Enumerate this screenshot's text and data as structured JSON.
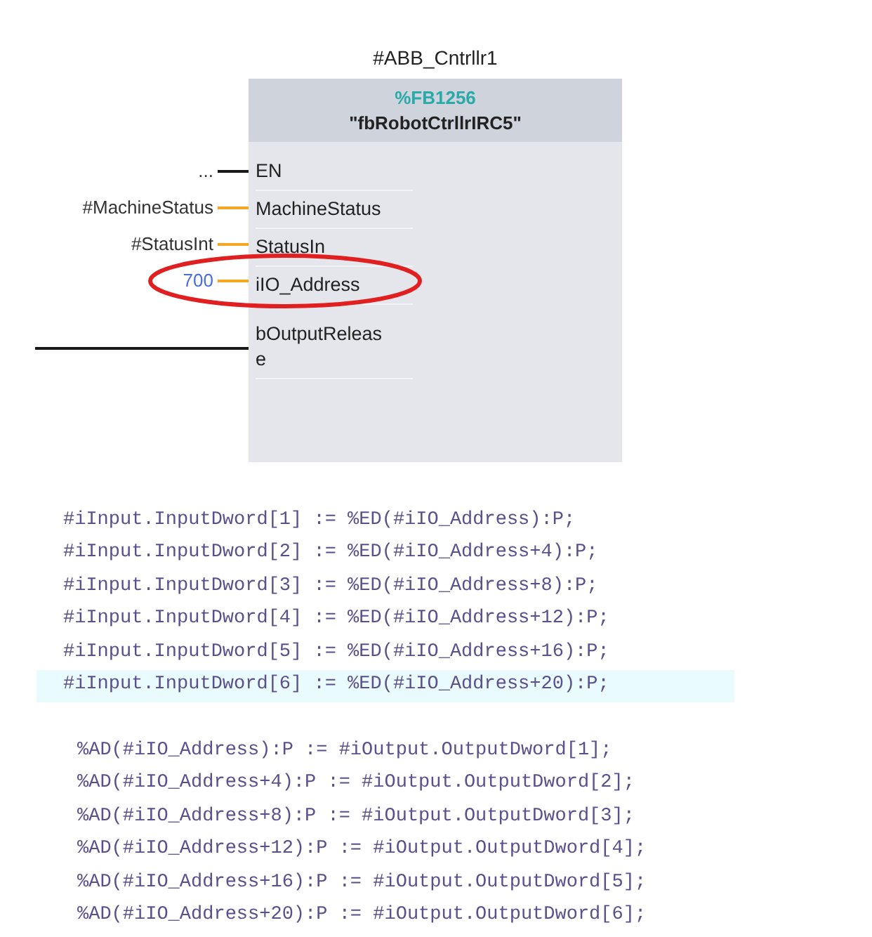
{
  "block": {
    "instance": "#ABB_Cntrllr1",
    "number": "%FB1256",
    "name": "\"fbRobotCtrllrIRC5\"",
    "pins": [
      {
        "label": "EN",
        "kind": "bool",
        "value": "...",
        "constant": false,
        "highlighted": false
      },
      {
        "label": "MachineStatus",
        "kind": "data",
        "value": "#MachineStatus",
        "constant": false,
        "highlighted": false
      },
      {
        "label": "StatusIn",
        "kind": "data",
        "value": "#StatusInt",
        "constant": false,
        "highlighted": false
      },
      {
        "label": "iIO_Address",
        "kind": "data",
        "value": "700",
        "constant": true,
        "highlighted": true
      },
      {
        "label": "bOutputReleas\ne",
        "kind": "bool",
        "highlighted": false
      }
    ]
  },
  "code_blocks": [
    {
      "lines": [
        {
          "text": "#iInput.InputDword[1] := %ED(#iIO_Address):P;",
          "selected": false
        },
        {
          "text": "#iInput.InputDword[2] := %ED(#iIO_Address+4):P;",
          "selected": false
        },
        {
          "text": "#iInput.InputDword[3] := %ED(#iIO_Address+8):P;",
          "selected": false
        },
        {
          "text": "#iInput.InputDword[4] := %ED(#iIO_Address+12):P;",
          "selected": false
        },
        {
          "text": "#iInput.InputDword[5] := %ED(#iIO_Address+16):P;",
          "selected": false
        },
        {
          "text": "#iInput.InputDword[6] := %ED(#iIO_Address+20):P;",
          "selected": true
        }
      ]
    },
    {
      "lines": [
        {
          "text": "%AD(#iIO_Address):P := #iOutput.OutputDword[1];",
          "selected": false
        },
        {
          "text": "%AD(#iIO_Address+4):P := #iOutput.OutputDword[2];",
          "selected": false
        },
        {
          "text": "%AD(#iIO_Address+8):P := #iOutput.OutputDword[3];",
          "selected": false
        },
        {
          "text": "%AD(#iIO_Address+12):P := #iOutput.OutputDword[4];",
          "selected": false
        },
        {
          "text": "%AD(#iIO_Address+16):P := #iOutput.OutputDword[5];",
          "selected": false
        },
        {
          "text": "%AD(#iIO_Address+20):P := #iOutput.OutputDword[6];",
          "selected": false
        }
      ]
    }
  ]
}
